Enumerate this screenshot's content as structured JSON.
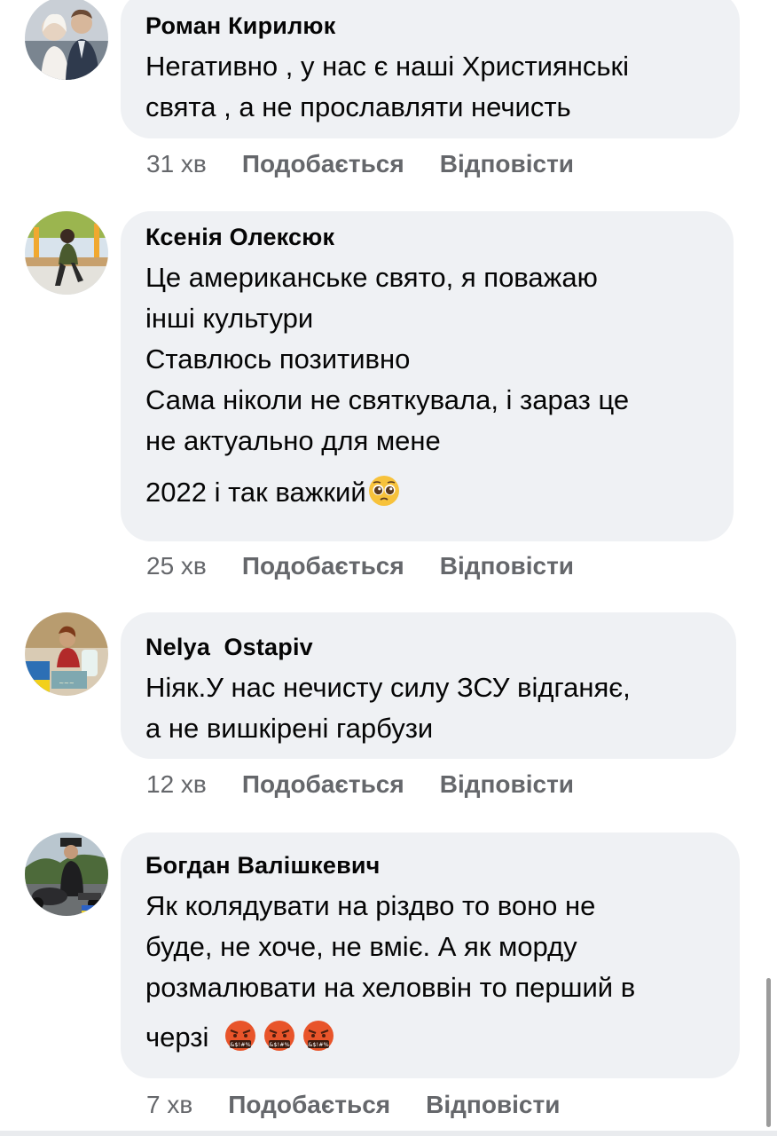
{
  "comments": [
    {
      "author": "Роман Кирилюк",
      "lines": [
        "Негативно , у нас є наші Християнські",
        "свята , а не прославляти нечисть"
      ],
      "time": "31 хв",
      "like": "Подобається",
      "reply": "Відповісти"
    },
    {
      "author": "Ксенія Олексюк",
      "lines": [
        "Це американське свято, я поважаю",
        "інші культури",
        "Ставлюсь позитивно",
        "Сама ніколи не святкувала, і зараз це",
        "не актуально для мене"
      ],
      "extra_line": "2022 і так важкий",
      "emoji": "pleading-face-emoji",
      "time": "25 хв",
      "like": "Подобається",
      "reply": "Відповісти"
    },
    {
      "author": "Nelya  Ostapiv",
      "lines": [
        "Ніяк.У нас нечисту силу ЗСУ відганяє,",
        "а не вишкірені гарбузи"
      ],
      "time": "12 хв",
      "like": "Подобається",
      "reply": "Відповісти"
    },
    {
      "author": "Богдан Валішкевич",
      "lines": [
        "Як колядувати на різдво то воно не",
        "буде, не хоче, не вміє. А як морду",
        "розмалювати на хеловвін то перший в"
      ],
      "extra_line": "черзі",
      "emoji": "face-with-symbols-on-mouth-emoji",
      "time": "7 хв",
      "like": "Подобається",
      "reply": "Відповісти"
    }
  ],
  "colors": {
    "bubble": "#eff1f4",
    "text": "#050505",
    "meta": "#65676b"
  }
}
